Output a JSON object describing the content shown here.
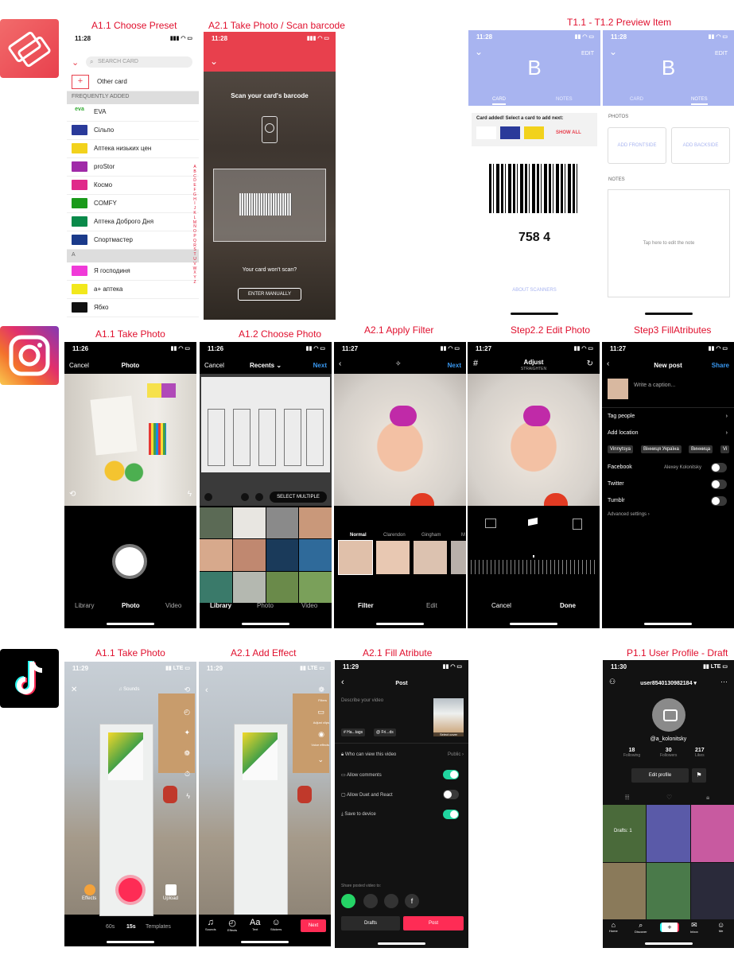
{
  "colors": {
    "label_red": "#e0102e",
    "stocard_red": "#e8404d",
    "stocard_lavender": "#a8b4f0",
    "ig_black": "#000000",
    "tiktok_pink": "#fe2c55",
    "tiktok_green": "#20d5a0"
  },
  "labels": {
    "stocard": [
      "A1.1 Choose Preset",
      "A2.1 Take Photo /  Scan barcode",
      "T1.1 - T1.2 Preview Item"
    ],
    "instagram": [
      "A1.1 Take Photo",
      "A1.2 Choose Photo",
      "A2.1 Apply Filter",
      "Step2.2 Edit Photo",
      "Step3 FillAtributes"
    ],
    "tiktok": [
      "A1.1 Take Photo",
      "A2.1 Add Effect",
      "A2.1 Fill Atribute",
      "P1.1 User Profile - Draft"
    ]
  },
  "status_times": {
    "stocard": "11:28",
    "ig1": "11:26",
    "ig2": "11:26",
    "ig3": "11:27",
    "ig4": "11:27",
    "ig5": "11:27",
    "tt1": "11:29",
    "tt2": "11:29",
    "tt3": "11:29",
    "tt4": "11:30"
  },
  "status_net": {
    "lte": "LTE"
  },
  "stocard_preset": {
    "search_placeholder": "SEARCH CARD",
    "other_card": "Other card",
    "section_frequent": "FREQUENTLY ADDED",
    "cards": [
      "EVA",
      "Сільпо",
      "Аптека низьких цен",
      "proStor",
      "Космо",
      "COMFY",
      "Аптека Доброго Дня",
      "Спортмастер"
    ],
    "section_a": "А",
    "cards_a": [
      "Я господиня",
      "а+ аптека",
      "Ябко"
    ],
    "alphabet": "ABCDEFGHIJKLMNOPQRSTUVWXYZ"
  },
  "stocard_scan": {
    "title": "Scan your card's barcode",
    "cant_scan": "Your card won't scan?",
    "enter_manually": "ENTER MANUALLY"
  },
  "stocard_preview": {
    "letter": "B",
    "edit": "EDIT",
    "tab_card": "CARD",
    "tab_notes": "NOTES",
    "card_added": "Card added! Select a card to add next:",
    "show_all": "SHOW ALL",
    "barcode_number": "758 4",
    "about_scanners": "ABOUT SCANNERS",
    "photos": "PHOTOS",
    "add_front": "ADD FRONTSIDE",
    "add_back": "ADD BACKSIDE",
    "notes": "NOTES",
    "tap_note": "Tap here to edit the note"
  },
  "ig_take": {
    "cancel": "Cancel",
    "title": "Photo",
    "tabs": [
      "Library",
      "Photo",
      "Video"
    ]
  },
  "ig_choose": {
    "cancel": "Cancel",
    "title": "Recents",
    "next": "Next",
    "select_multiple": "SELECT MULTIPLE",
    "tabs": [
      "Library",
      "Photo",
      "Video"
    ]
  },
  "ig_filter": {
    "next": "Next",
    "filters": [
      "Normal",
      "Clarendon",
      "Gingham",
      "M"
    ],
    "tabs": [
      "Filter",
      "Edit"
    ]
  },
  "ig_edit": {
    "title": "Adjust",
    "subtitle": "STRAIGHTEN",
    "cancel": "Cancel",
    "done": "Done"
  },
  "ig_post": {
    "title": "New post",
    "share": "Share",
    "caption": "Write a caption...",
    "tag_people": "Tag people",
    "add_location": "Add location",
    "locations": [
      "Vinnytsya",
      "Вінниця Україна",
      "Винница",
      "Vi"
    ],
    "facebook": "Facebook",
    "facebook_user": "Alexey Kolonitsky",
    "twitter": "Twitter",
    "tumblr": "Tumblr",
    "advanced": "Advanced settings"
  },
  "tt_take": {
    "sounds": "Sounds",
    "effects": "Effects",
    "upload": "Upload",
    "durations": [
      "60s",
      "15s",
      "Templates"
    ]
  },
  "tt_effect": {
    "side_labels": [
      "Filters",
      "Adjust clips",
      "Voice effects"
    ],
    "tools": [
      "Sounds",
      "Effects",
      "Text",
      "Stickers"
    ],
    "next": "Next"
  },
  "tt_post": {
    "title": "Post",
    "describe": "Describe your video",
    "select_cover": "Select cover",
    "hashtags": "# Ha...tags",
    "friends": "@ Fri...ds",
    "who_can_view": "Who can view this video",
    "public": "Public",
    "allow_comments": "Allow comments",
    "allow_duet": "Allow Duet and React",
    "save_device": "Save to device",
    "share_to": "Share posted video to:",
    "drafts": "Drafts",
    "post": "Post"
  },
  "tt_profile": {
    "username": "user8540130982184",
    "handle": "@a_kolonitsky",
    "stats": [
      {
        "n": "18",
        "l": "Following"
      },
      {
        "n": "30",
        "l": "Followers"
      },
      {
        "n": "217",
        "l": "Likes"
      }
    ],
    "edit_profile": "Edit profile",
    "drafts": "Drafts: 1",
    "tabs": [
      "Home",
      "Discover",
      "",
      "Inbox",
      "Me"
    ]
  }
}
